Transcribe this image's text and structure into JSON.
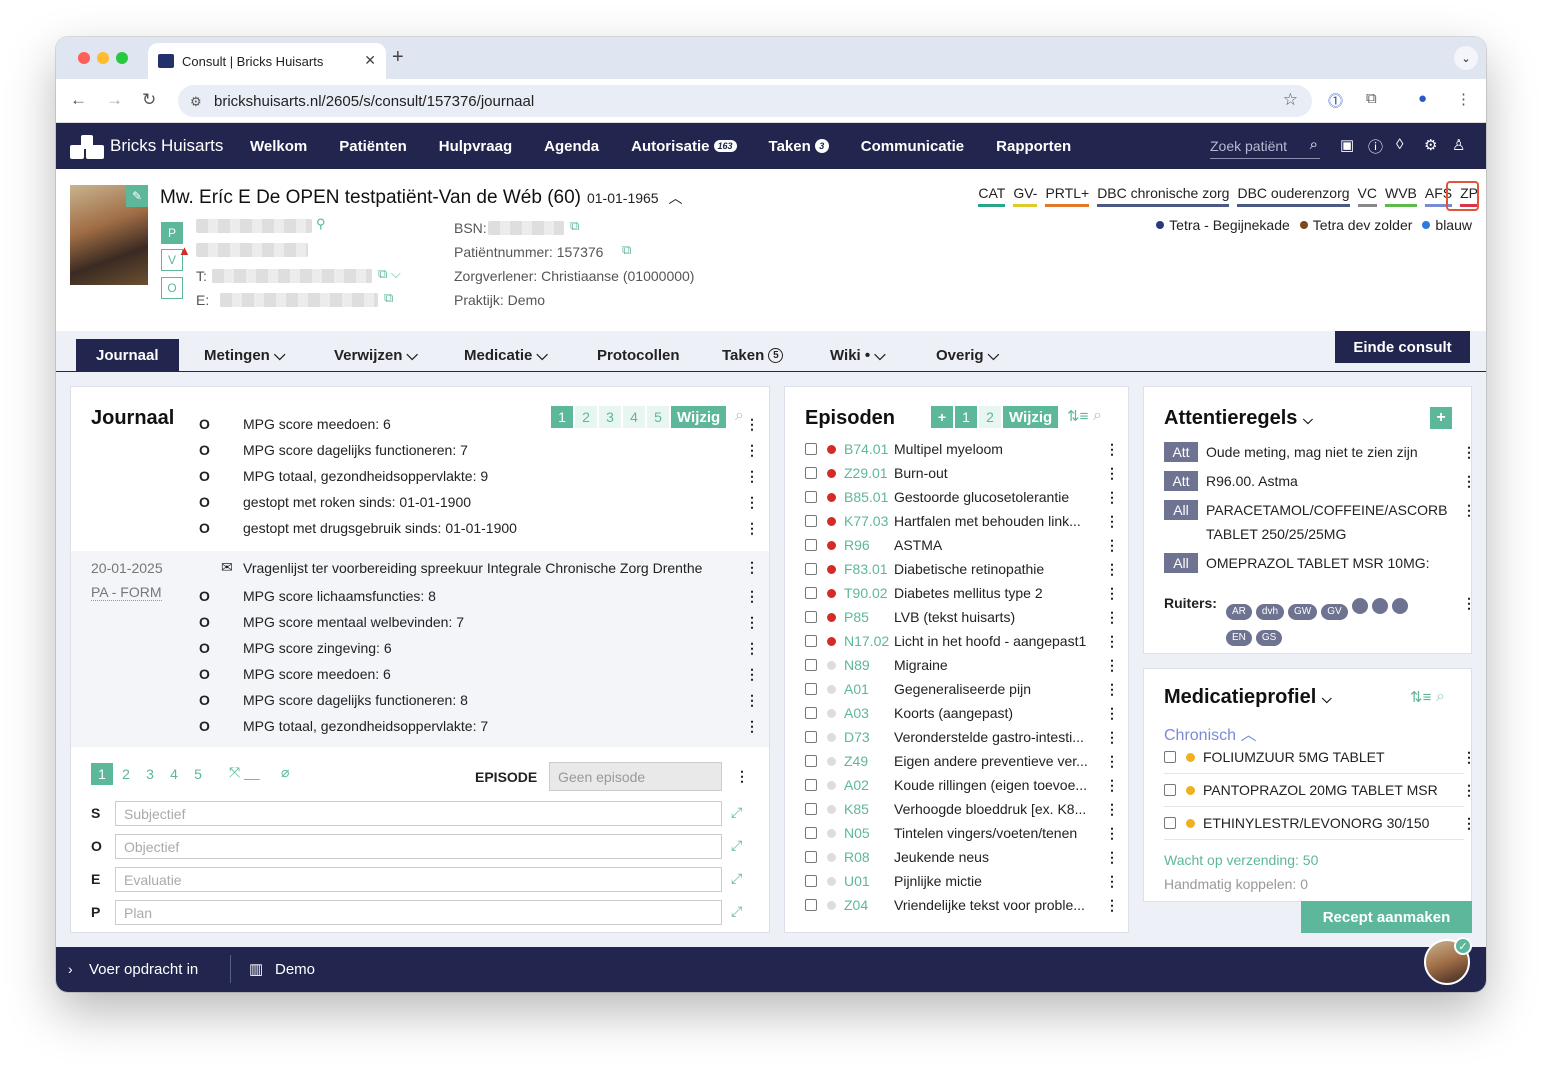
{
  "browser": {
    "tab_title": "Consult | Bricks Huisarts",
    "url": "brickshuisarts.nl/2605/s/consult/157376/journaal"
  },
  "app": {
    "brand": "Bricks Huisarts",
    "menu": [
      {
        "label": "Welkom"
      },
      {
        "label": "Patiënten"
      },
      {
        "label": "Hulpvraag"
      },
      {
        "label": "Agenda"
      },
      {
        "label": "Autorisatie",
        "badge": "163"
      },
      {
        "label": "Taken",
        "badge": "3"
      },
      {
        "label": "Communicatie"
      },
      {
        "label": "Rapporten"
      }
    ],
    "search_placeholder": "Zoek patiënt"
  },
  "patient": {
    "name": "Mw. Eríc E De OPEN testpatiënt-Van de Wéb (60)",
    "dob": "01-01-1965",
    "pvo": [
      "P",
      "V",
      "O"
    ],
    "t_label": "T:",
    "e_label": "E:",
    "bsn_label": "BSN:",
    "patientnummer": "Patiëntnummer: 157376",
    "zorgverlener": "Zorgverlener: Christiaanse (01000000)",
    "praktijk": "Praktijk:  Demo",
    "flags": [
      {
        "label": "CAT",
        "color": "#2aa58a"
      },
      {
        "label": "GV-",
        "color": "#e2c92a"
      },
      {
        "label": "PRTL+",
        "color": "#e07a2a"
      },
      {
        "label": "DBC chronische zorg",
        "color": "#4b5a85"
      },
      {
        "label": "DBC ouderenzorg",
        "color": "#4b5a85"
      },
      {
        "label": "VC",
        "color": "#888888"
      },
      {
        "label": "WVB",
        "color": "#5dbb4a"
      },
      {
        "label": "AFS",
        "color": "#7a8bd6"
      },
      {
        "label": "ZP",
        "color": "#d8344b"
      }
    ],
    "locations": [
      {
        "label": "Tetra - Begijnekade",
        "color": "#2a3a7a"
      },
      {
        "label": "Tetra dev zolder",
        "color": "#7a4a1a"
      },
      {
        "label": "blauw",
        "color": "#2a7ae0"
      }
    ]
  },
  "subtabs": [
    {
      "label": "Journaal"
    },
    {
      "label": "Metingen"
    },
    {
      "label": "Verwijzen"
    },
    {
      "label": "Medicatie"
    },
    {
      "label": "Protocollen"
    },
    {
      "label": "Taken",
      "badge": "5"
    },
    {
      "label": "Wiki"
    },
    {
      "label": "Overig"
    }
  ],
  "einde_consult": "Einde consult",
  "journaal": {
    "title": "Journaal",
    "pages": [
      "1",
      "2",
      "3",
      "4",
      "5"
    ],
    "wijzig": "Wijzig",
    "rows_top": [
      {
        "o": "O",
        "text": "MPG score meedoen: 6"
      },
      {
        "o": "O",
        "text": "MPG score dagelijks functioneren: 7"
      },
      {
        "o": "O",
        "text": "MPG totaal, gezondheidsoppervlakte: 9"
      },
      {
        "o": "O",
        "text": "gestopt met roken sinds: 01-01-1900"
      },
      {
        "o": "O",
        "text": "gestopt met drugsgebruik sinds: 01-01-1900"
      }
    ],
    "entry_date": "20-01-2025",
    "entry_author": "PA - FORM",
    "entry_title": "Vragenlijst ter voorbereiding spreekuur Integrale Chronische Zorg Drenthe",
    "rows_entry": [
      {
        "o": "O",
        "text": "MPG score lichaamsfuncties: 8"
      },
      {
        "o": "O",
        "text": "MPG score mentaal welbevinden: 7"
      },
      {
        "o": "O",
        "text": "MPG score zingeving: 6"
      },
      {
        "o": "O",
        "text": "MPG score meedoen: 6"
      },
      {
        "o": "O",
        "text": "MPG score dagelijks functioneren: 8"
      },
      {
        "o": "O",
        "text": "MPG totaal, gezondheidsoppervlakte: 7"
      }
    ],
    "episode_label": "EPISODE",
    "episode_placeholder": "Geen episode",
    "soep": [
      {
        "letter": "S",
        "placeholder": "Subjectief"
      },
      {
        "letter": "O",
        "placeholder": "Objectief"
      },
      {
        "letter": "E",
        "placeholder": "Evaluatie"
      },
      {
        "letter": "P",
        "placeholder": "Plan"
      }
    ]
  },
  "episoden": {
    "title": "Episoden",
    "pages": [
      "1",
      "2"
    ],
    "wijzig": "Wijzig",
    "items": [
      {
        "code": "B74.01",
        "text": "Multipel myeloom",
        "dot": "#d42a2a"
      },
      {
        "code": "Z29.01",
        "text": "Burn-out",
        "dot": "#d42a2a"
      },
      {
        "code": "B85.01",
        "text": "Gestoorde glucosetolerantie",
        "dot": "#d42a2a"
      },
      {
        "code": "K77.03",
        "text": "Hartfalen met behouden link...",
        "dot": "#d42a2a"
      },
      {
        "code": "R96",
        "text": "ASTMA",
        "dot": "#d42a2a"
      },
      {
        "code": "F83.01",
        "text": "Diabetische retinopathie",
        "dot": "#d42a2a"
      },
      {
        "code": "T90.02",
        "text": "Diabetes mellitus type 2",
        "dot": "#d42a2a"
      },
      {
        "code": "P85",
        "text": "LVB (tekst huisarts)",
        "dot": "#d42a2a"
      },
      {
        "code": "N17.02",
        "text": "Licht in het hoofd - aangepast1",
        "dot": "#d42a2a"
      },
      {
        "code": "N89",
        "text": "Migraine",
        "dot": "#dddddd"
      },
      {
        "code": "A01",
        "text": "Gegeneraliseerde pijn",
        "dot": "#dddddd"
      },
      {
        "code": "A03",
        "text": "Koorts (aangepast)",
        "dot": "#dddddd"
      },
      {
        "code": "D73",
        "text": "Veronderstelde gastro-intesti...",
        "dot": "#dddddd"
      },
      {
        "code": "Z49",
        "text": "Eigen andere preventieve ver...",
        "dot": "#dddddd"
      },
      {
        "code": "A02",
        "text": "Koude rillingen (eigen toevoe...",
        "dot": "#dddddd"
      },
      {
        "code": "K85",
        "text": "Verhoogde bloeddruk [ex. K8...",
        "dot": "#dddddd"
      },
      {
        "code": "N05",
        "text": "Tintelen vingers/voeten/tenen",
        "dot": "#dddddd"
      },
      {
        "code": "R08",
        "text": "Jeukende neus",
        "dot": "#dddddd"
      },
      {
        "code": "U01",
        "text": "Pijnlijke mictie",
        "dot": "#dddddd"
      },
      {
        "code": "Z04",
        "text": "Vriendelijke tekst voor proble...",
        "dot": "#dddddd"
      }
    ]
  },
  "attentieregels": {
    "title": "Attentieregels",
    "items": [
      {
        "tag": "Att",
        "text": "Oude meting, mag niet te zien zijn"
      },
      {
        "tag": "Att",
        "text": "R96.00. Astma"
      },
      {
        "tag": "All",
        "text": "PARACETAMOL/COFFEINE/ASCORB TABLET 250/25/25MG"
      },
      {
        "tag": "All",
        "text": "OMEPRAZOL TABLET MSR 10MG:"
      }
    ],
    "ruiters_label": "Ruiters:",
    "ruiters": [
      "AR",
      "dvh",
      "GW",
      "GV",
      "",
      "",
      "",
      "EN",
      "GS"
    ]
  },
  "medicatie": {
    "title": "Medicatieprofiel",
    "section": "Chronisch",
    "items": [
      {
        "text": "FOLIUMZUUR 5MG TABLET"
      },
      {
        "text": "PANTOPRAZOL 20MG TABLET MSR"
      },
      {
        "text": "ETHINYLESTR/LEVONORG 30/150"
      }
    ],
    "wacht": "Wacht op verzending: 50",
    "handmatig": "Handmatig koppelen: 0",
    "recept": "Recept aanmaken"
  },
  "statusbar": {
    "command": "Voer opdracht in",
    "practice": "Demo"
  }
}
